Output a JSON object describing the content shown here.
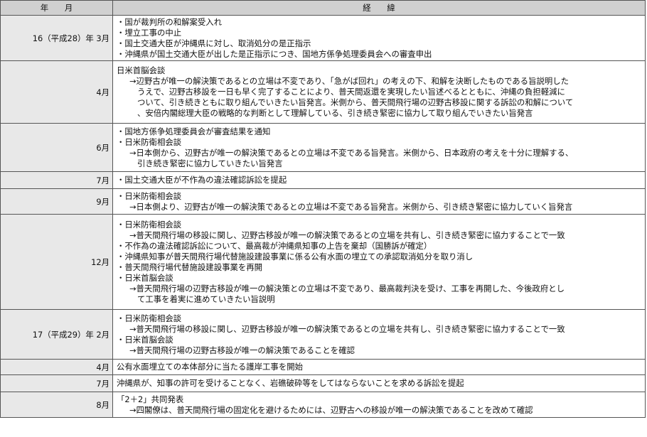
{
  "header": {
    "date_col": "年　　月",
    "body_col": "経　　緯"
  },
  "rows": [
    {
      "date": "16（平成28）年  3月",
      "lines": [
        {
          "t": "・国が裁判所の和解案受入れ",
          "k": "line"
        },
        {
          "t": "・埋立工事の中止",
          "k": "line"
        },
        {
          "t": "・国土交通大臣が沖縄県に対し、取消処分の是正指示",
          "k": "line"
        },
        {
          "t": "・沖縄県が国土交通大臣が出した是正指示につき、国地方係争処理委員会への審査申出",
          "k": "line"
        }
      ]
    },
    {
      "date": "4月",
      "lines": [
        {
          "t": "日米首脳会談",
          "k": "line"
        },
        {
          "t": "→辺野古が唯一の解決策であるとの立場は不変であり、「急がば回れ」の考えの下、和解を決断したものである旨説明した",
          "k": "sub"
        },
        {
          "t": "うえで、辺野古移設を一日も早く完了することにより、普天間返還を実現したい旨述べるとともに、沖縄の負担軽減に",
          "k": "cont"
        },
        {
          "t": "ついて、引き続きともに取り組んでいきたい旨発言。米側から、普天間飛行場の辺野古移設に関する訴訟の和解について",
          "k": "cont"
        },
        {
          "t": "、安倍内閣総理大臣の戦略的な判断として理解している、引き続き緊密に協力して取り組んでいきたい旨発言",
          "k": "cont"
        }
      ]
    },
    {
      "date": "6月",
      "lines": [
        {
          "t": "・国地方係争処理委員会が審査結果を通知",
          "k": "line"
        },
        {
          "t": "・日米防衛相会談",
          "k": "line"
        },
        {
          "t": "→日本側から、辺野古が唯一の解決策であるとの立場は不変である旨発言。米側から、日本政府の考えを十分に理解する、",
          "k": "sub"
        },
        {
          "t": "引き続き緊密に協力していきたい旨発言",
          "k": "cont"
        }
      ]
    },
    {
      "date": "7月",
      "lines": [
        {
          "t": "・国土交通大臣が不作為の違法確認訴訟を提起",
          "k": "line"
        }
      ]
    },
    {
      "date": "9月",
      "lines": [
        {
          "t": "・日米防衛相会談",
          "k": "line"
        },
        {
          "t": "→日本側より、辺野古が唯一の解決策であるとの立場は不変である旨発言。米側から、引き続き緊密に協力していく旨発言",
          "k": "sub"
        }
      ]
    },
    {
      "date": "12月",
      "lines": [
        {
          "t": "・日米防衛相会談",
          "k": "line"
        },
        {
          "t": "→普天間飛行場の移設に関し、辺野古移設が唯一の解決策であるとの立場を共有し、引き続き緊密に協力することで一致",
          "k": "sub"
        },
        {
          "t": "・不作為の違法確認訴訟について、最高裁が沖縄県知事の上告を棄却（国勝訴が確定）",
          "k": "line"
        },
        {
          "t": "・沖縄県知事が普天間飛行場代替施設建設事業に係る公有水面の埋立ての承認取消処分を取り消し",
          "k": "line"
        },
        {
          "t": "・普天間飛行場代替施設建設事業を再開",
          "k": "line"
        },
        {
          "t": "・日米首脳会談",
          "k": "line"
        },
        {
          "t": "→普天間飛行場の辺野古移設が唯一の解決策との立場は不変であり、最高裁判決を受け、工事を再開した、今後政府とし",
          "k": "sub"
        },
        {
          "t": "て工事を着実に進めていきたい旨説明",
          "k": "cont"
        }
      ]
    },
    {
      "date": "17（平成29）年  2月",
      "lines": [
        {
          "t": "・日米防衛相会談",
          "k": "line"
        },
        {
          "t": "→普天間飛行場の移設に関し、辺野古移設が唯一の解決策であるとの立場を共有し、引き続き緊密に協力することで一致",
          "k": "sub"
        },
        {
          "t": "・日米首脳会談",
          "k": "line"
        },
        {
          "t": "→普天間飛行場の辺野古移設が唯一の解決策であることを確認",
          "k": "sub"
        }
      ]
    },
    {
      "date": "4月",
      "lines": [
        {
          "t": "公有水面埋立ての本体部分に当たる護岸工事を開始",
          "k": "line"
        }
      ]
    },
    {
      "date": "7月",
      "lines": [
        {
          "t": "沖縄県が、知事の許可を受けることなく、岩礁破砕等をしてはならないことを求める訴訟を提起",
          "k": "line"
        }
      ]
    },
    {
      "date": "8月",
      "lines": [
        {
          "t": "「2＋2」共同発表",
          "k": "line"
        },
        {
          "t": "→四閣僚は、普天間飛行場の固定化を避けるためには、辺野古への移設が唯一の解決策であることを改めて確認",
          "k": "sub"
        }
      ]
    }
  ]
}
